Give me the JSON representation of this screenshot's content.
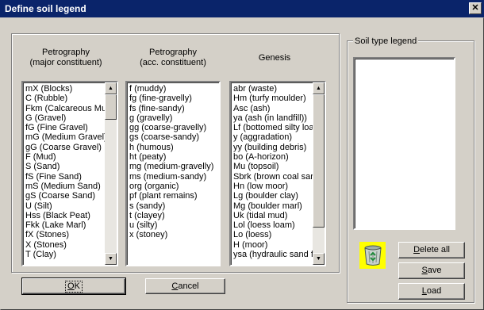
{
  "window": {
    "title": "Define soil legend",
    "close_glyph": "✕"
  },
  "columns": {
    "petrography_major": {
      "header_line1": "Petrography",
      "header_line2": "(major constituent)",
      "items": [
        "mX (Blocks)",
        "C (Rubble)",
        "Fkm (Calcareous Mud",
        "G (Gravel)",
        "fG (Fine Gravel)",
        "mG (Medium Gravel)",
        "gG (Coarse Gravel)",
        "F (Mud)",
        "S (Sand)",
        "fS (Fine Sand)",
        "mS (Medium Sand)",
        "gS (Coarse Sand)",
        "U (Silt)",
        "Hss (Black Peat)",
        "Fkk (Lake Marl)",
        "fX (Stones)",
        "X (Stones)",
        "T (Clay)"
      ]
    },
    "petrography_acc": {
      "header_line1": "Petrography",
      "header_line2": "(acc. constituent)",
      "items": [
        "f (muddy)",
        "fg (fine-gravelly)",
        "fs (fine-sandy)",
        "g (gravelly)",
        "gg (coarse-gravelly)",
        "gs (coarse-sandy)",
        "h (humous)",
        "ht (peaty)",
        "mg (medium-gravelly)",
        "ms (medium-sandy)",
        "org (organic)",
        "pf (plant remains)",
        "s (sandy)",
        "t (clayey)",
        "u (silty)",
        "x (stoney)"
      ]
    },
    "genesis": {
      "header": "Genesis",
      "items": [
        "abr (waste)",
        "Hm (turfy moulder)",
        "Asc (ash)",
        "ya (ash (in landfill))",
        "Lf (bottomed silty loa",
        "y (aggradation)",
        "yy (building debris)",
        "bo (A-horizon)",
        "Mu (topsoil)",
        "Sbrk (brown coal sar",
        "Hn (low moor)",
        "Lg (boulder clay)",
        "Mg (boulder marl)",
        "Uk (tidal mud)",
        "Lol (loess loam)",
        "Lo (loess)",
        "H (moor)",
        "ysa (hydraulic sand fi"
      ]
    }
  },
  "legend_group": {
    "label": "Soil type legend",
    "items": []
  },
  "buttons": {
    "delete_all": {
      "pre": "",
      "u": "D",
      "post": "elete all"
    },
    "save": {
      "pre": "",
      "u": "S",
      "post": "ave"
    },
    "load": {
      "pre": "",
      "u": "L",
      "post": "oad"
    },
    "ok": {
      "pre": "",
      "u": "O",
      "post": "K"
    },
    "cancel": {
      "pre": "",
      "u": "C",
      "post": "ancel"
    }
  },
  "icons": {
    "trash": "recycle-bin-icon",
    "trash_bg": "#ffff00",
    "title_bar_color": "#0a246a"
  }
}
